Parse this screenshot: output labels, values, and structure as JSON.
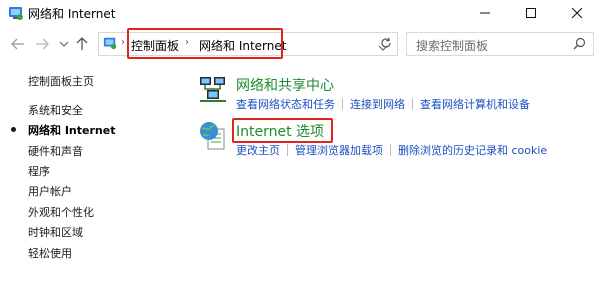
{
  "window": {
    "title": "网络和 Internet"
  },
  "address": {
    "crumb1": "控制面板",
    "crumb2": "网络和 Internet"
  },
  "search": {
    "placeholder": "搜索控制面板"
  },
  "sidebar": {
    "items": [
      {
        "label": "控制面板主页"
      },
      {
        "label": "系统和安全"
      },
      {
        "label": "网络和 Internet"
      },
      {
        "label": "硬件和声音"
      },
      {
        "label": "程序"
      },
      {
        "label": "用户帐户"
      },
      {
        "label": "外观和个性化"
      },
      {
        "label": "时钟和区域"
      },
      {
        "label": "轻松使用"
      }
    ]
  },
  "sections": [
    {
      "title": "网络和共享中心",
      "icon": "network-sharing-icon",
      "links": [
        "查看网络状态和任务",
        "连接到网络",
        "查看网络计算机和设备"
      ]
    },
    {
      "title": "Internet 选项",
      "icon": "internet-options-icon",
      "links": [
        "更改主页",
        "管理浏览器加载项",
        "删除浏览的历史记录和 cookie"
      ]
    }
  ],
  "colors": {
    "highlight_box": "#e0241e",
    "category_title": "#1e8a2f",
    "link": "#1a4fbf"
  }
}
